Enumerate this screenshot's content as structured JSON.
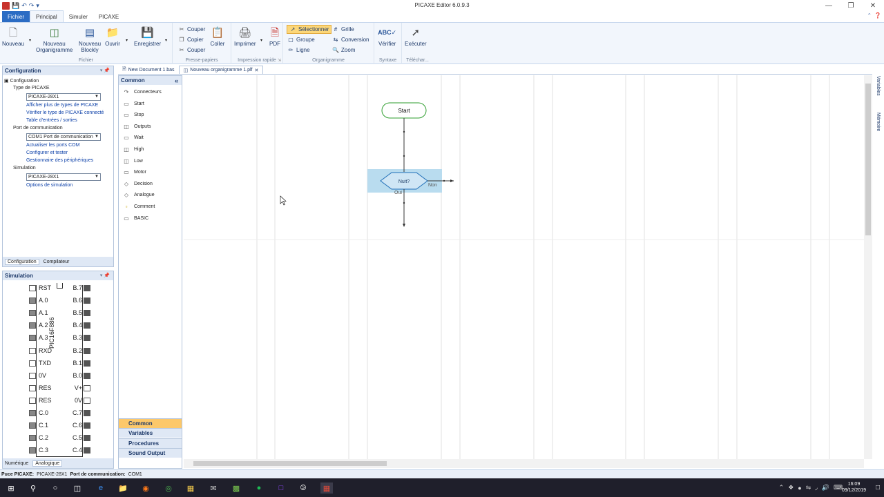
{
  "window": {
    "title": "PICAXE Editor 6.0.9.3",
    "qa_icons": [
      "save-icon",
      "undo-icon",
      "redo-icon"
    ]
  },
  "ribbon_tabs": [
    "Fichier",
    "Principal",
    "Simuler",
    "PICAXE"
  ],
  "ribbon": {
    "fichier": {
      "label": "Fichier",
      "nouveau": "Nouveau",
      "nouveau_org_1": "Nouveau",
      "nouveau_org_2": "Organigramme",
      "nouveau_blockly_1": "Nouveau",
      "nouveau_blockly_2": "Blockly",
      "ouvrir": "Ouvrir",
      "enregistrer": "Enregistrer"
    },
    "presse": {
      "label": "Presse-papiers",
      "couper": "Couper",
      "copier": "Copier",
      "couper2": "Couper",
      "coller": "Coller"
    },
    "impression": {
      "label": "Impression rapide",
      "imprimer": "Imprimer",
      "pdf": "PDF"
    },
    "organigramme": {
      "label": "Organigramme",
      "selectionner": "Sélectionner",
      "groupe": "Groupe",
      "ligne": "Ligne",
      "grille": "Grille",
      "conversion": "Conversion",
      "zoom": "Zoom"
    },
    "syntaxe": {
      "label": "Syntaxe",
      "verifier": "Vérifier"
    },
    "telecharger": {
      "label": "Téléchar...",
      "executer": "Exécuter"
    }
  },
  "config_panel": {
    "title": "Configuration",
    "root": "Configuration",
    "type_picaxe": "Type de PICAXE",
    "picaxe_combo": "PICAXE-28X1",
    "link_afficher": "Afficher plus de types de PICAXE",
    "link_verifier": "Vérifier le type de PICAXE connecté",
    "link_table": "Table d'entrées / sorties",
    "port": "Port de communication",
    "port_combo": "COM1 Port de communication",
    "link_actualiser": "Actualiser les ports COM",
    "link_configurer": "Configurer et tester",
    "link_gestionnaire": "Gestionnaire des périphériques",
    "simulation": "Simulation",
    "sim_combo": "PICAXE-28X1",
    "link_options": "Options de simulation",
    "tab_config": "Configuration",
    "tab_compilateur": "Compilateur"
  },
  "sim_panel": {
    "title": "Simulation",
    "chip_name": "PIC16F886",
    "pins": [
      {
        "l": "RST",
        "r": "B.7"
      },
      {
        "l": "A.0",
        "r": "B.6"
      },
      {
        "l": "A.1",
        "r": "B.5"
      },
      {
        "l": "A.2",
        "r": "B.4"
      },
      {
        "l": "A.3",
        "r": "B.3"
      },
      {
        "l": "RXD",
        "r": "B.2"
      },
      {
        "l": "TXD",
        "r": "B.1"
      },
      {
        "l": "0V",
        "r": "B.0"
      },
      {
        "l": "RES",
        "r": "V+"
      },
      {
        "l": "RES",
        "r": "0V"
      },
      {
        "l": "C.0",
        "r": "C.7"
      },
      {
        "l": "C.1",
        "r": "C.6"
      },
      {
        "l": "C.2",
        "r": "C.5"
      },
      {
        "l": "C.3",
        "r": "C.4"
      }
    ],
    "tab_numerique": "Numérique",
    "tab_analogique": "Analogique"
  },
  "doc_tabs": [
    "New Document 1.bas",
    "Nouveau organigramme 1.plf"
  ],
  "toolbox": {
    "title": "Common",
    "items": [
      "Connecteurs",
      "Start",
      "Stop",
      "Outputs",
      "Wait",
      "High",
      "Low",
      "Motor",
      "Decision",
      "Analogue",
      "Comment",
      "BASIC"
    ],
    "categories": [
      "Common",
      "Variables",
      "Procedures",
      "Sound Output"
    ]
  },
  "flowchart": {
    "start_label": "Start",
    "decision_label": "Nuit?",
    "yes_label": "Oui",
    "no_label": "Non"
  },
  "status_bar": {
    "puce_label": "Puce PICAXE:",
    "puce_value": "PICAXE-28X1",
    "port_label": "Port de communication:",
    "port_value": "COM1"
  },
  "taskbar": {
    "time": "16:09",
    "date": "09/12/2019"
  },
  "colors": {
    "accent": "#2b6cc4",
    "selected": "#fcd77a",
    "start_node": "#2e9e2e",
    "decision_node": "#1f6fb8",
    "decision_highlight": "#b9dcef"
  }
}
